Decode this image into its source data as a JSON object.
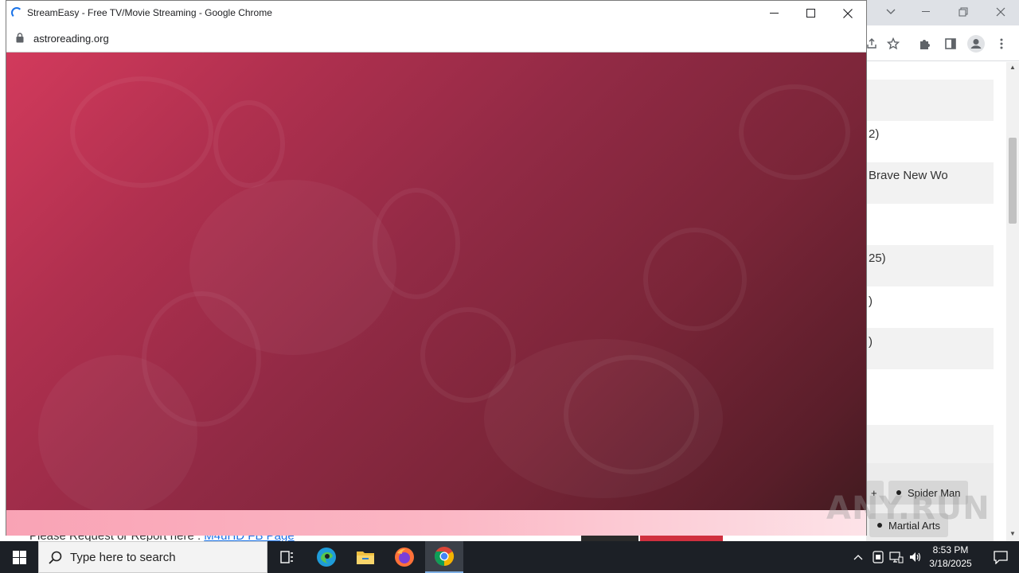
{
  "popup": {
    "title": "StreamEasy - Free TV/Movie Streaming - Google Chrome",
    "url": "astroreading.org"
  },
  "background_page": {
    "rows": [
      {
        "text": "2)"
      },
      {
        "text": "Brave New Wo"
      },
      {
        "text": "25)"
      },
      {
        "text": ")"
      },
      {
        "text": ")"
      }
    ],
    "tags": {
      "plus": "+",
      "spider_man": "Spider Man",
      "martial_arts": "Martial Arts"
    },
    "request_text": "Please Request or Report here : ",
    "request_link": "M4uHD FB Page"
  },
  "watermark": "ANY.RUN",
  "taskbar": {
    "search_placeholder": "Type here to search",
    "time": "8:53 PM",
    "date": "3/18/2025"
  },
  "colors": {
    "banner_gradient_start": "#d23a5c",
    "banner_gradient_end": "#3e1a1e",
    "pink_bar": "#fbb6c4",
    "taskbar": "#1c2026"
  }
}
